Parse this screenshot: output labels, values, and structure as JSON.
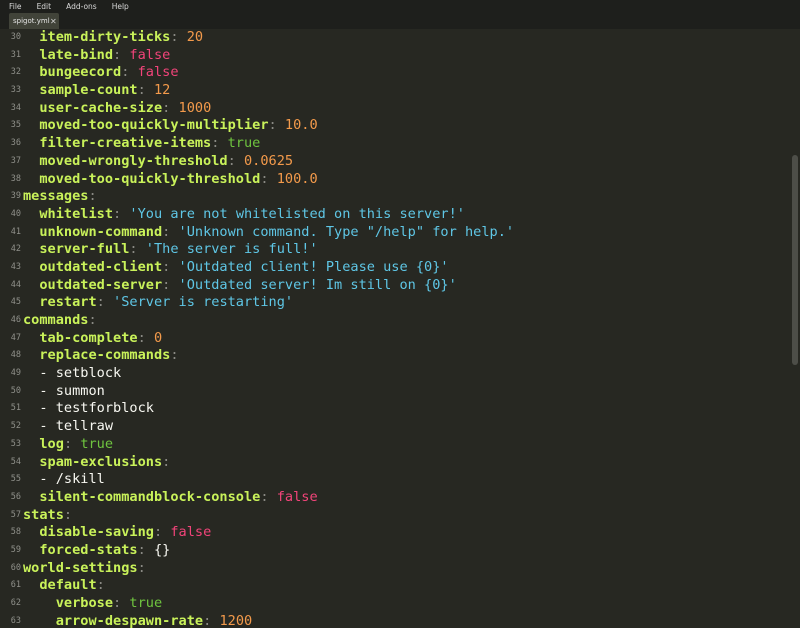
{
  "menu": [
    "File",
    "Edit",
    "Add-ons",
    "Help"
  ],
  "tab": {
    "label": "spigot.yml",
    "close": "✕"
  },
  "lines": [
    {
      "n": "30",
      "indent": "  ",
      "key": "item-dirty-ticks",
      "sep": ":",
      "val": "20",
      "vt": "n"
    },
    {
      "n": "31",
      "indent": "  ",
      "key": "late-bind",
      "sep": ":",
      "val": "false",
      "vt": "bf"
    },
    {
      "n": "32",
      "indent": "  ",
      "key": "bungeecord",
      "sep": ":",
      "val": "false",
      "vt": "bf"
    },
    {
      "n": "33",
      "indent": "  ",
      "key": "sample-count",
      "sep": ":",
      "val": "12",
      "vt": "n"
    },
    {
      "n": "34",
      "indent": "  ",
      "key": "user-cache-size",
      "sep": ":",
      "val": "1000",
      "vt": "n"
    },
    {
      "n": "35",
      "indent": "  ",
      "key": "moved-too-quickly-multiplier",
      "sep": ":",
      "val": "10.0",
      "vt": "n"
    },
    {
      "n": "36",
      "indent": "  ",
      "key": "filter-creative-items",
      "sep": ":",
      "val": "true",
      "vt": "bt"
    },
    {
      "n": "37",
      "indent": "  ",
      "key": "moved-wrongly-threshold",
      "sep": ":",
      "val": "0.0625",
      "vt": "n"
    },
    {
      "n": "38",
      "indent": "  ",
      "key": "moved-too-quickly-threshold",
      "sep": ":",
      "val": "100.0",
      "vt": "n"
    },
    {
      "n": "39",
      "indent": "",
      "key": "messages",
      "sep": ":",
      "val": "",
      "vt": "t"
    },
    {
      "n": "40",
      "indent": "  ",
      "key": "whitelist",
      "sep": ":",
      "val": "'You are not whitelisted on this server!'",
      "vt": "s"
    },
    {
      "n": "41",
      "indent": "  ",
      "key": "unknown-command",
      "sep": ":",
      "val": "'Unknown command. Type \"/help\" for help.'",
      "vt": "s"
    },
    {
      "n": "42",
      "indent": "  ",
      "key": "server-full",
      "sep": ":",
      "val": "'The server is full!'",
      "vt": "s"
    },
    {
      "n": "43",
      "indent": "  ",
      "key": "outdated-client",
      "sep": ":",
      "val": "'Outdated client! Please use {0}'",
      "vt": "s"
    },
    {
      "n": "44",
      "indent": "  ",
      "key": "outdated-server",
      "sep": ":",
      "val": "'Outdated server! Im still on {0}'",
      "vt": "s"
    },
    {
      "n": "45",
      "indent": "  ",
      "key": "restart",
      "sep": ":",
      "val": "'Server is restarting'",
      "vt": "s"
    },
    {
      "n": "46",
      "indent": "",
      "key": "commands",
      "sep": ":",
      "val": "",
      "vt": "t"
    },
    {
      "n": "47",
      "indent": "  ",
      "key": "tab-complete",
      "sep": ":",
      "val": "0",
      "vt": "n"
    },
    {
      "n": "48",
      "indent": "  ",
      "key": "replace-commands",
      "sep": ":",
      "val": "",
      "vt": "t"
    },
    {
      "n": "49",
      "indent": "  ",
      "key": "",
      "sep": "",
      "val": "- setblock",
      "vt": "t"
    },
    {
      "n": "50",
      "indent": "  ",
      "key": "",
      "sep": "",
      "val": "- summon",
      "vt": "t"
    },
    {
      "n": "51",
      "indent": "  ",
      "key": "",
      "sep": "",
      "val": "- testforblock",
      "vt": "t"
    },
    {
      "n": "52",
      "indent": "  ",
      "key": "",
      "sep": "",
      "val": "- tellraw",
      "vt": "t"
    },
    {
      "n": "53",
      "indent": "  ",
      "key": "log",
      "sep": ":",
      "val": "true",
      "vt": "bt"
    },
    {
      "n": "54",
      "indent": "  ",
      "key": "spam-exclusions",
      "sep": ":",
      "val": "",
      "vt": "t"
    },
    {
      "n": "55",
      "indent": "  ",
      "key": "",
      "sep": "",
      "val": "- /skill",
      "vt": "t"
    },
    {
      "n": "56",
      "indent": "  ",
      "key": "silent-commandblock-console",
      "sep": ":",
      "val": "false",
      "vt": "bf"
    },
    {
      "n": "57",
      "indent": "",
      "key": "stats",
      "sep": ":",
      "val": "",
      "vt": "t"
    },
    {
      "n": "58",
      "indent": "  ",
      "key": "disable-saving",
      "sep": ":",
      "val": "false",
      "vt": "bf"
    },
    {
      "n": "59",
      "indent": "  ",
      "key": "forced-stats",
      "sep": ":",
      "val": "{}",
      "vt": "t"
    },
    {
      "n": "60",
      "indent": "",
      "key": "world-settings",
      "sep": ":",
      "val": "",
      "vt": "t"
    },
    {
      "n": "61",
      "indent": "  ",
      "key": "default",
      "sep": ":",
      "val": "",
      "vt": "t"
    },
    {
      "n": "62",
      "indent": "    ",
      "key": "verbose",
      "sep": ":",
      "val": "true",
      "vt": "bt"
    },
    {
      "n": "63",
      "indent": "    ",
      "key": "arrow-despawn-rate",
      "sep": ":",
      "val": "1200",
      "vt": "n"
    }
  ]
}
